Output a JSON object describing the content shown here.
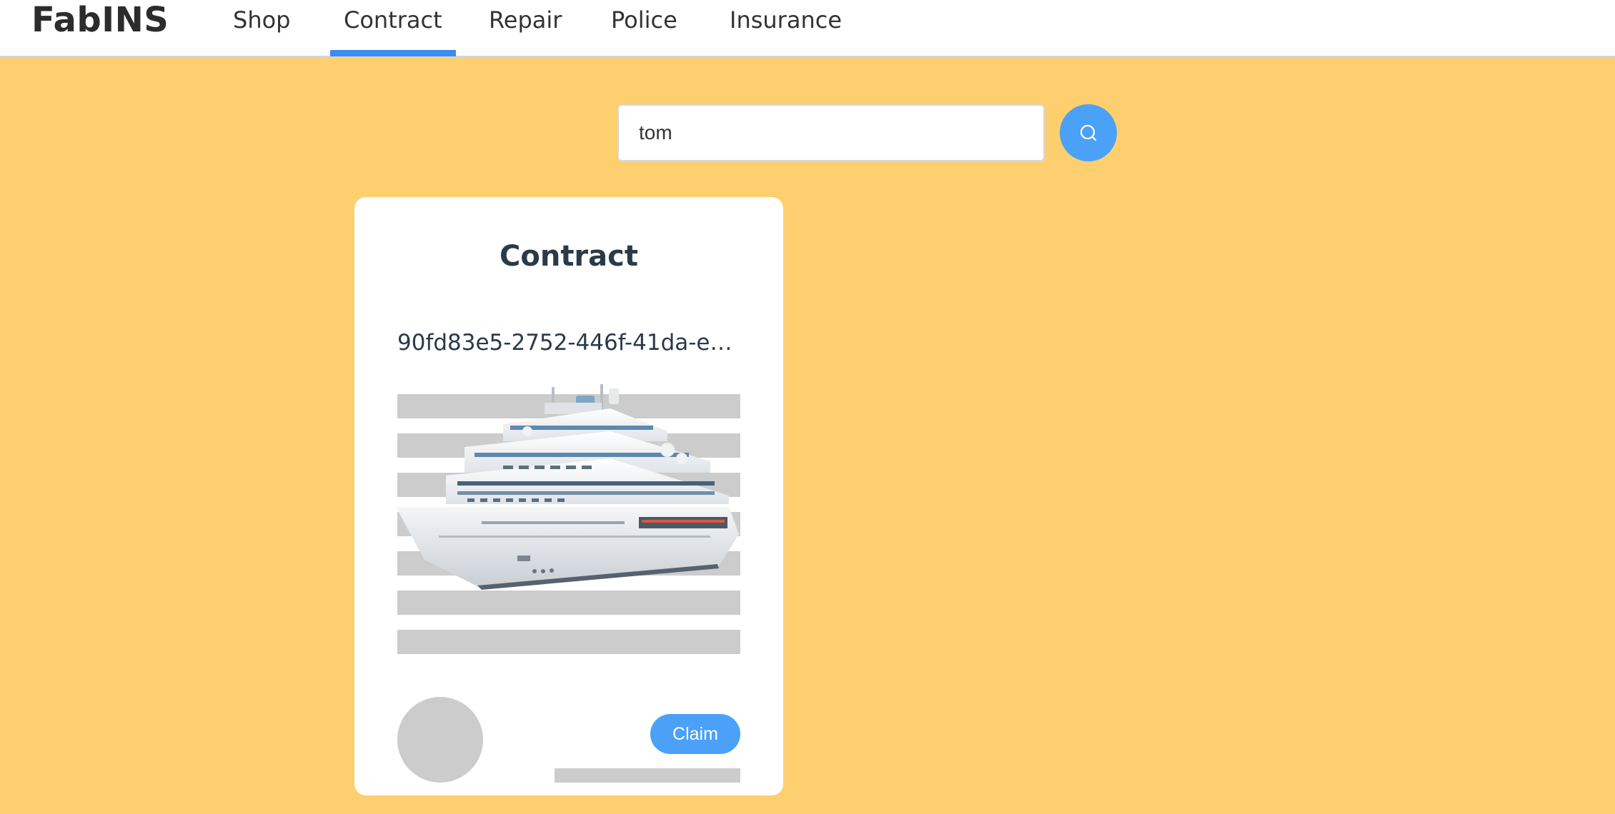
{
  "app": {
    "brand": "FabINS"
  },
  "nav": {
    "tabs": [
      {
        "label": "Shop",
        "active": false
      },
      {
        "label": "Contract",
        "active": true
      },
      {
        "label": "Repair",
        "active": false
      },
      {
        "label": "Police",
        "active": false
      },
      {
        "label": "Insurance",
        "active": false
      }
    ]
  },
  "search": {
    "value": "tom",
    "button_icon": "search-icon"
  },
  "card": {
    "title": "Contract",
    "contract_id": "90fd83e5-2752-446f-41da-ee2…",
    "image_icon": "cruise-ship-image",
    "claim_label": "Claim"
  },
  "colors": {
    "page_background": "#fdcf6e",
    "accent": "#4aa1f7",
    "active_tab_underline": "#3d8cf0",
    "skeleton": "#cccccc",
    "card_text": "#2b3a48"
  }
}
